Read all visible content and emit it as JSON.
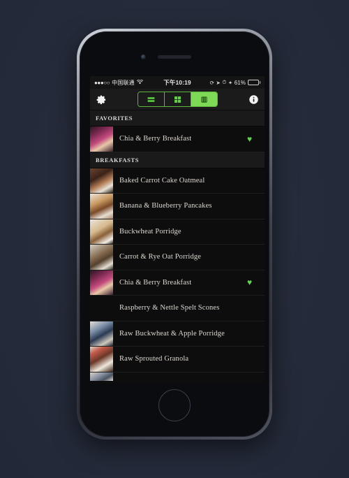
{
  "device": {
    "name": "iphone-mockup"
  },
  "status_bar": {
    "signal_dots": "●●●○○",
    "carrier": "中国联通",
    "wifi_icon": "wifi-icon",
    "time": "下午10:19",
    "rotation_lock_icon": "rotation-lock-icon",
    "location_icon": "location-arrow-icon",
    "alarm_icon": "alarm-icon",
    "bluetooth_icon": "bluetooth-icon",
    "battery_percent": "61%",
    "battery_level": 61,
    "battery_color": "#5ed94a"
  },
  "toolbar": {
    "settings_icon": "gear-icon",
    "info_icon": "info-icon",
    "accent_color": "#7ed957",
    "segments": [
      {
        "name": "list-view",
        "icon": "list-rows-icon",
        "selected": false
      },
      {
        "name": "grid-view",
        "icon": "grid-squares-icon",
        "selected": false
      },
      {
        "name": "book-view",
        "icon": "book-icon",
        "selected": true
      }
    ]
  },
  "list": {
    "sections": [
      {
        "header": "FAVORITES",
        "rows": [
          {
            "title": "Chia & Berry Breakfast",
            "favorite": true,
            "thumb": "smoothie-pink"
          }
        ]
      },
      {
        "header": "BREAKFASTS",
        "rows": [
          {
            "title": "Baked Carrot Cake Oatmeal",
            "favorite": false,
            "thumb": "oatmeal-dark"
          },
          {
            "title": "Banana & Blueberry Pancakes",
            "favorite": false,
            "thumb": "pancakes"
          },
          {
            "title": "Buckwheat Porridge",
            "favorite": false,
            "thumb": "porridge-bowl"
          },
          {
            "title": "Carrot & Rye Oat Porridge",
            "favorite": false,
            "thumb": "porridge-grey"
          },
          {
            "title": "Chia & Berry Breakfast",
            "favorite": true,
            "thumb": "smoothie-pink"
          },
          {
            "title": "Raspberry & Nettle Spelt Scones",
            "favorite": false,
            "thumb": "scones"
          },
          {
            "title": "Raw Buckwheat & Apple Porridge",
            "favorite": false,
            "thumb": "buckwheat-blue"
          },
          {
            "title": "Raw Sprouted Granola",
            "favorite": false,
            "thumb": "granola"
          },
          {
            "title": "",
            "favorite": false,
            "thumb": "partial-row",
            "partial": true
          }
        ]
      }
    ],
    "heart_glyph": "♥",
    "heart_color": "#5ed94a"
  }
}
